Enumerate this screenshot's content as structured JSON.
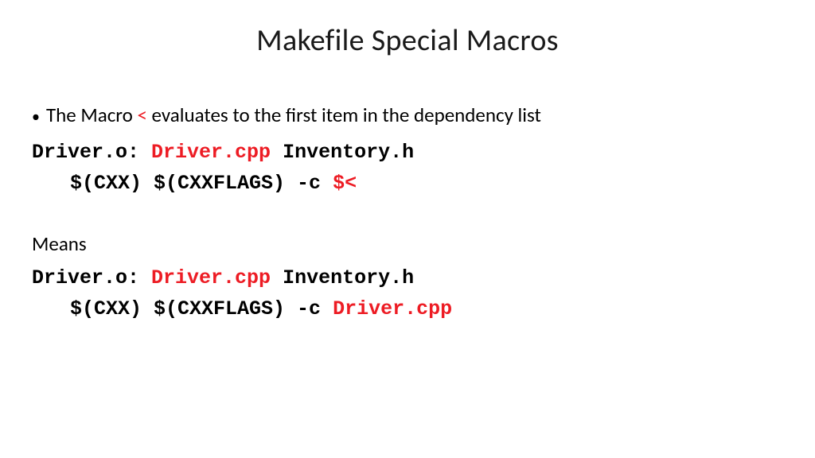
{
  "title": "Makefile Special Macros",
  "bullet": {
    "pre": "The Macro ",
    "macro": "<",
    "post": " evaluates to the first item in the dependency list"
  },
  "block1": {
    "l1_a": "Driver.o: ",
    "l1_b": "Driver.cpp",
    "l1_c": " Inventory.h",
    "l2_a": "$(CXX) $(CXXFLAGS) -c ",
    "l2_b": "$<"
  },
  "means": "Means",
  "block2": {
    "l1_a": "Driver.o: ",
    "l1_b": "Driver.cpp",
    "l1_c": " Inventory.h",
    "l2_a": "$(CXX) $(CXXFLAGS) -c ",
    "l2_b": "Driver.cpp"
  }
}
